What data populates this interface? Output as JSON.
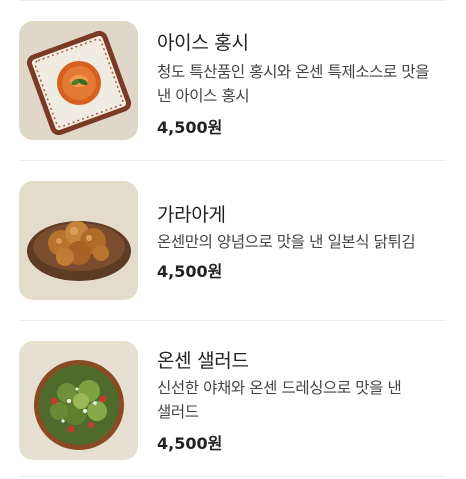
{
  "menu": {
    "items": [
      {
        "name": "아이스 홍시",
        "description": "청도 특산품인 홍시와 온센 특제소스로 맛을 낸 아이스 홍시",
        "price": "4,500원",
        "image_icon": "ice-persimmon-dish-image"
      },
      {
        "name": "가라아게",
        "description": "온센만의 양념으로 맛을 낸 일본식 닭튀김",
        "price": "4,500원",
        "image_icon": "karaage-dish-image"
      },
      {
        "name": "온센 샐러드",
        "description": "신선한 야채와 온센 드레싱으로 맛을 낸 샐러드",
        "price": "4,500원",
        "image_icon": "salad-dish-image"
      }
    ]
  }
}
